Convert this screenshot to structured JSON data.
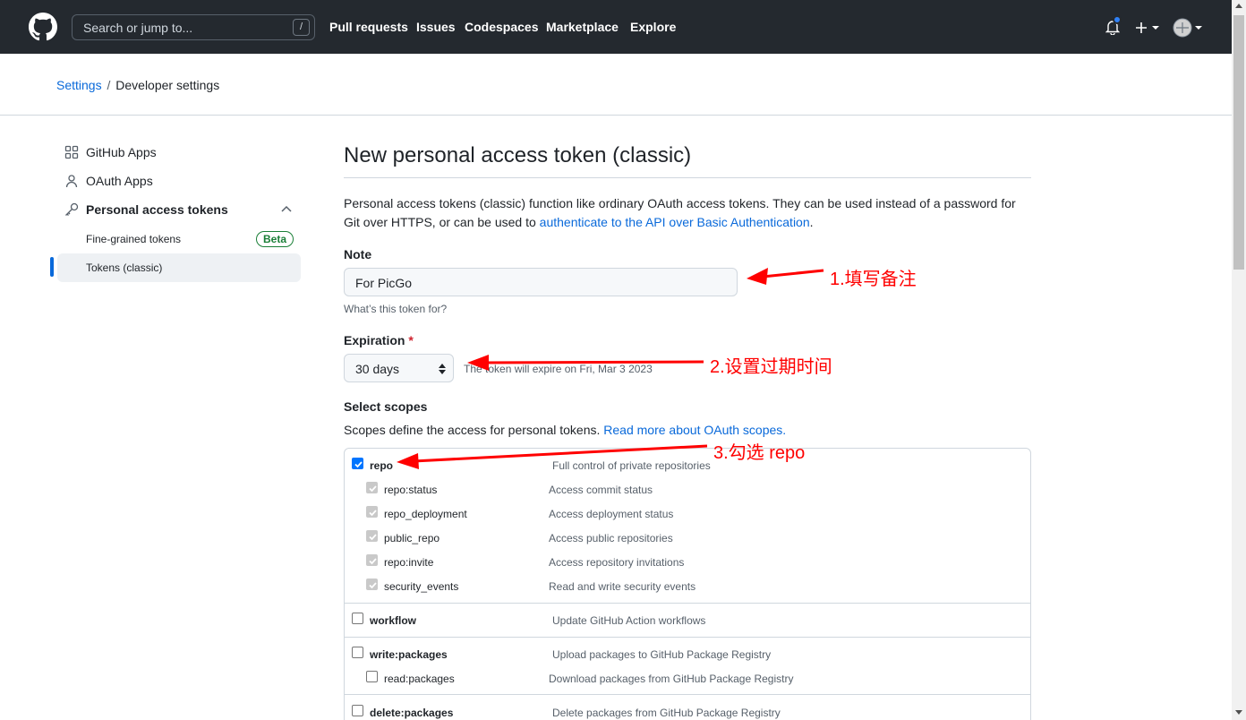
{
  "header": {
    "search_placeholder": "Search or jump to...",
    "search_shortcut": "/",
    "nav": [
      "Pull requests",
      "Issues",
      "Codespaces",
      "Marketplace",
      "Explore"
    ],
    "notification_color": "#2f81f7"
  },
  "breadcrumb": {
    "parent": "Settings",
    "separator": "/",
    "current": "Developer settings"
  },
  "sidebar": {
    "items": [
      {
        "label": "GitHub Apps",
        "icon": "apps-icon"
      },
      {
        "label": "OAuth Apps",
        "icon": "person-icon"
      },
      {
        "label": "Personal access tokens",
        "icon": "key-icon"
      }
    ],
    "sub_items": [
      {
        "label": "Fine-grained tokens",
        "badge": "Beta"
      },
      {
        "label": "Tokens (classic)",
        "active": true
      }
    ]
  },
  "main": {
    "title": "New personal access token (classic)",
    "description_prefix": "Personal access tokens (classic) function like ordinary OAuth access tokens. They can be used instead of a password for Git over HTTPS, or can be used to ",
    "description_link": "authenticate to the API over Basic Authentication",
    "description_suffix": ".",
    "note_label": "Note",
    "note_value": "For PicGo",
    "note_hint": "What’s this token for?",
    "expiration_label": "Expiration",
    "expiration_required": "*",
    "expiration_value": "30 days",
    "expiration_note": "The token will expire on Fri, Mar 3 2023",
    "scopes_label": "Select scopes",
    "scopes_desc": "Scopes define the access for personal tokens. ",
    "scopes_link": "Read more about OAuth scopes."
  },
  "scopes": [
    {
      "name": "repo",
      "desc": "Full control of private repositories",
      "checked": true,
      "parent": true
    },
    {
      "name": "repo:status",
      "desc": "Access commit status",
      "checked": true,
      "disabled": true
    },
    {
      "name": "repo_deployment",
      "desc": "Access deployment status",
      "checked": true,
      "disabled": true
    },
    {
      "name": "public_repo",
      "desc": "Access public repositories",
      "checked": true,
      "disabled": true
    },
    {
      "name": "repo:invite",
      "desc": "Access repository invitations",
      "checked": true,
      "disabled": true
    },
    {
      "name": "security_events",
      "desc": "Read and write security events",
      "checked": true,
      "disabled": true
    },
    {
      "name": "workflow",
      "desc": "Update GitHub Action workflows",
      "checked": false,
      "parent": true
    },
    {
      "name": "write:packages",
      "desc": "Upload packages to GitHub Package Registry",
      "checked": false,
      "parent": true
    },
    {
      "name": "read:packages",
      "desc": "Download packages from GitHub Package Registry",
      "checked": false
    },
    {
      "name": "delete:packages",
      "desc": "Delete packages from GitHub Package Registry",
      "checked": false,
      "parent": true
    }
  ],
  "annotations": {
    "step1": "1.填写备注",
    "step2": "2.设置过期时间",
    "step3": "3.勾选 repo",
    "color": "#ff0000"
  }
}
